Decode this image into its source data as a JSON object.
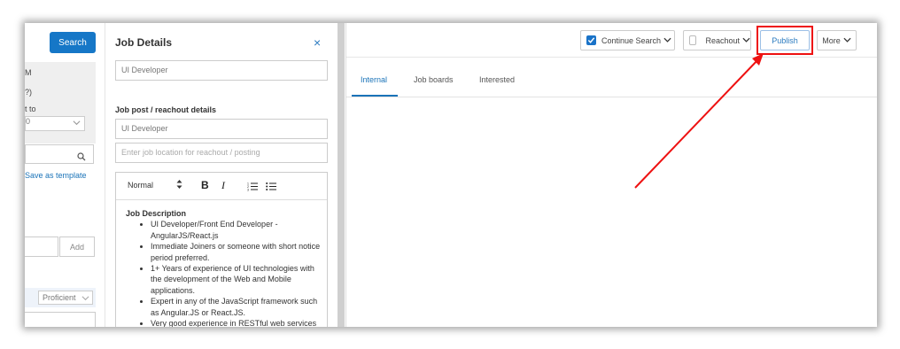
{
  "left_panel": {
    "search_button": "Search",
    "grey_lines": [
      "M",
      "?)",
      "t to"
    ],
    "select_value": "0",
    "save_template_link": "Save as template",
    "add_button": "Add",
    "proficiency_select": "Proficient"
  },
  "job_details": {
    "title": "Job Details",
    "close_icon": "×",
    "job_title_value": "UI Developer",
    "section_label": "Job post / reachout details",
    "post_title_value": "UI Developer",
    "location_placeholder": "Enter job location for reachout / posting",
    "editor": {
      "format_select": "Normal",
      "bold": "B",
      "italic": "I",
      "heading": "Job Description",
      "bullets": [
        "UI Developer/Front End Developer - AngularJS/React.js",
        "Immediate Joiners or someone with short notice period preferred.",
        "1+ Years of experience of UI technologies with the development of the Web and Mobile applications.",
        "Expert in any of the JavaScript framework such as Angular.JS or React.JS.",
        "Very good experience in RESTful web services"
      ]
    }
  },
  "right_panel": {
    "continue_search": "Continue Search",
    "reachout": "Reachout",
    "publish": "Publish",
    "more": "More",
    "tabs": [
      "Internal",
      "Job boards",
      "Interested"
    ]
  },
  "colors": {
    "accent": "#1677c7",
    "highlight_red": "#ee1111"
  }
}
